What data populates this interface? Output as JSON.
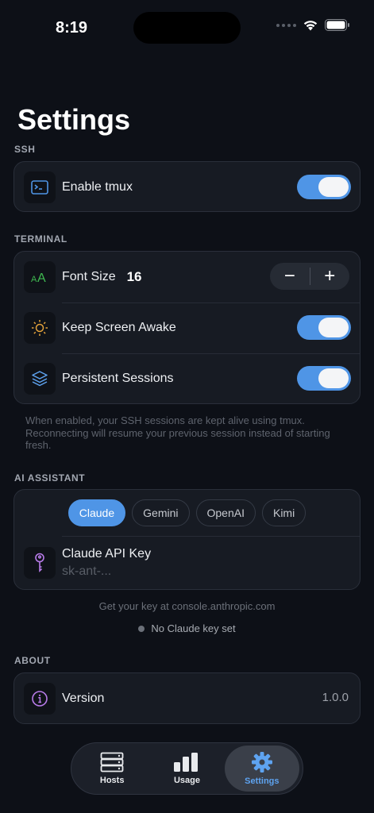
{
  "status_bar": {
    "time": "8:19"
  },
  "page": {
    "title": "Settings"
  },
  "ssh": {
    "section_label": "SSH",
    "enable_tmux": {
      "label": "Enable tmux",
      "enabled": true,
      "icon": "terminal-icon"
    }
  },
  "terminal": {
    "section_label": "TERMINAL",
    "font_size": {
      "label": "Font Size",
      "value": "16",
      "decrement": "−",
      "increment": "+",
      "icon": "font-size-icon"
    },
    "keep_awake": {
      "label": "Keep Screen Awake",
      "enabled": true,
      "icon": "sun-icon"
    },
    "persistent": {
      "label": "Persistent Sessions",
      "enabled": true,
      "icon": "layers-icon"
    },
    "hint": "When enabled, your SSH sessions are kept alive using tmux. Reconnecting will resume your previous session instead of starting fresh."
  },
  "ai": {
    "section_label": "AI ASSISTANT",
    "providers": [
      "Claude",
      "Gemini",
      "OpenAI",
      "Kimi"
    ],
    "selected_provider": "Claude",
    "api_key": {
      "label": "Claude API Key",
      "placeholder": "sk-ant-...",
      "icon": "key-icon"
    },
    "help": "Get your key at console.anthropic.com",
    "status": "No Claude key set"
  },
  "about": {
    "section_label": "ABOUT",
    "version": {
      "label": "Version",
      "value": "1.0.0",
      "icon": "info-icon"
    }
  },
  "tabbar": {
    "tabs": [
      {
        "label": "Hosts",
        "icon": "server-icon"
      },
      {
        "label": "Usage",
        "icon": "bar-chart-icon"
      },
      {
        "label": "Settings",
        "icon": "gear-icon"
      }
    ],
    "active": "Settings"
  },
  "colors": {
    "accent": "#4f95e6",
    "background": "#0d1017",
    "card": "#171b23"
  }
}
